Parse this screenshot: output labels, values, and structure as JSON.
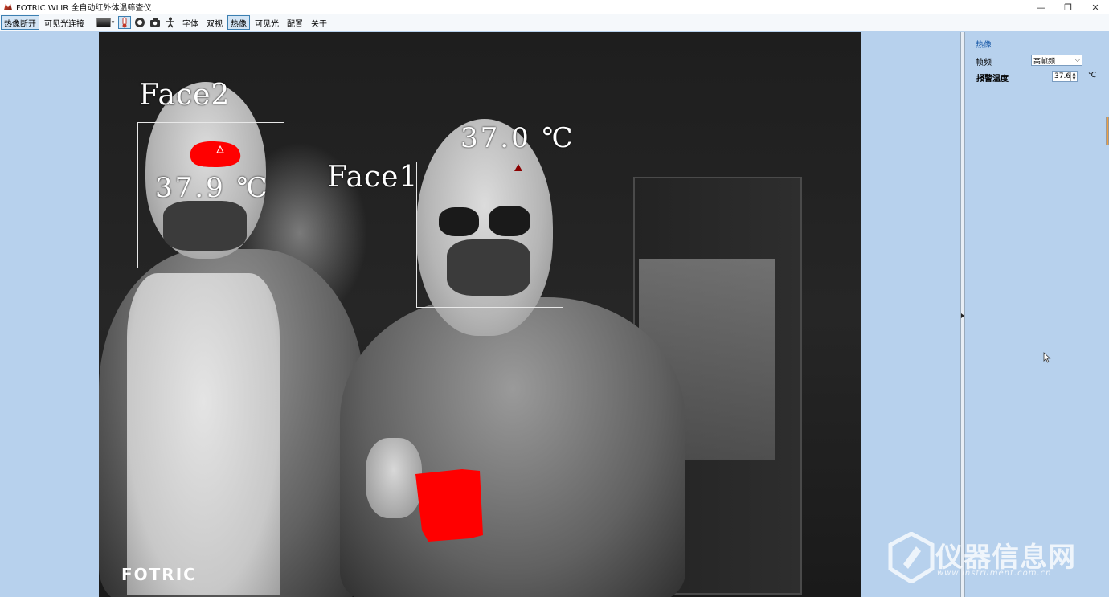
{
  "window": {
    "title": "FOTRIC WLIR 全自动红外体温筛查仪",
    "minimize": "—",
    "restore": "❐",
    "close": "✕"
  },
  "toolbar": {
    "thermal_disconnect": "热像断开",
    "visible_connect": "可见光连接",
    "font": "字体",
    "dual_view": "双视",
    "thermal": "热像",
    "visible": "可见光",
    "config": "配置",
    "about": "关于"
  },
  "viewer": {
    "face2_label": "Face2",
    "face2_temp": "37.9 ℃",
    "face1_label": "Face1",
    "face1_temp": "37.0 ℃",
    "logo": "FOTRIC"
  },
  "right_panel": {
    "section_title": "热像",
    "frame_rate_label": "帧频",
    "frame_rate_value": "高帧频",
    "alarm_temp_label": "报警温度",
    "alarm_temp_value": "37.6",
    "alarm_temp_unit": "℃"
  },
  "watermark": {
    "brand": "仪器信息网",
    "url": "www.instrument.com.cn"
  },
  "colors": {
    "alarm_red": "#ff0000",
    "panel_blue": "#b7d1ed",
    "accent_blue": "#1a5aa8"
  }
}
